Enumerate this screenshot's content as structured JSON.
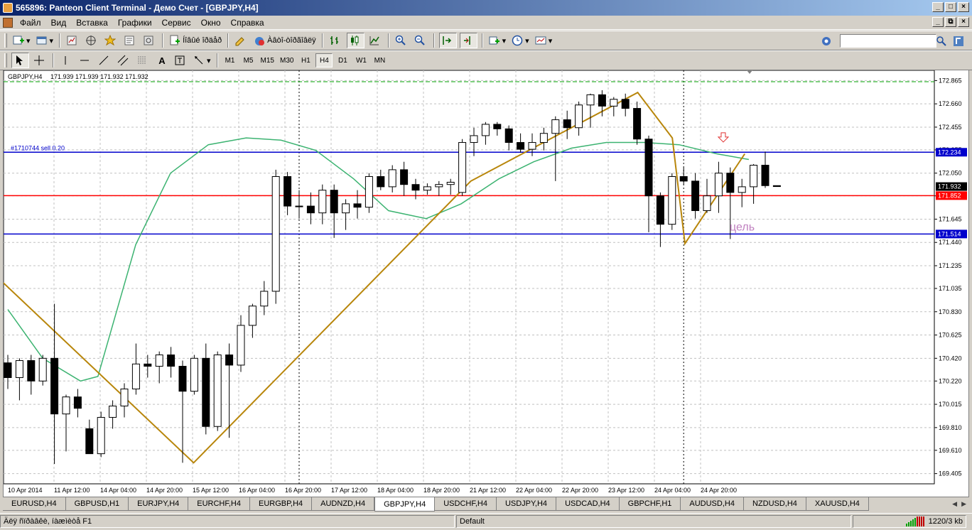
{
  "window": {
    "title": "565896: Panteon Client Terminal - Демо Счет - [GBPJPY,H4]",
    "buttons": [
      "_",
      "□",
      "×"
    ],
    "mdi_buttons": [
      "_",
      "⧉",
      "×"
    ]
  },
  "menu": [
    "Файл",
    "Вид",
    "Вставка",
    "Графики",
    "Сервис",
    "Окно",
    "Справка"
  ],
  "toolbar1": {
    "new_order_label": "Íîâûé îðäåð",
    "expert_label": "Àâòî-òîðãîâëÿ"
  },
  "toolbar2": {
    "timeframes": [
      "M1",
      "M5",
      "M15",
      "M30",
      "H1",
      "H4",
      "D1",
      "W1",
      "MN"
    ],
    "active_timeframe": "H4",
    "text_tool": "A"
  },
  "search": {
    "value": ""
  },
  "chart_data": {
    "type": "candlestick",
    "symbol_label": "GBPJPY,H4",
    "ohlc_header": "171.939 171.939 171.932 171.932",
    "order_label": "#1710744 sell 0.20",
    "target_label": "цель",
    "ylim": [
      169.315,
      172.955
    ],
    "y_ticks": [
      "172.865",
      "172.660",
      "172.455",
      "172.255",
      "172.050",
      "171.850",
      "171.645",
      "171.440",
      "171.235",
      "171.035",
      "170.830",
      "170.625",
      "170.420",
      "170.220",
      "170.015",
      "169.810",
      "169.610",
      "169.405"
    ],
    "x_labels": [
      "10 Apr 2014",
      "11 Apr 12:00",
      "14 Apr 04:00",
      "14 Apr 20:00",
      "15 Apr 12:00",
      "16 Apr 04:00",
      "16 Apr 20:00",
      "17 Apr 12:00",
      "18 Apr 04:00",
      "18 Apr 20:00",
      "21 Apr 12:00",
      "22 Apr 04:00",
      "22 Apr 20:00",
      "23 Apr 12:00",
      "24 Apr 04:00",
      "24 Apr 20:00"
    ],
    "price_labels": [
      {
        "value": 172.234,
        "text": "172.234",
        "color": "#0000cc"
      },
      {
        "value": 171.932,
        "text": "171.932",
        "color": "#000000"
      },
      {
        "value": 171.852,
        "text": "171.852",
        "color": "#ff0000"
      },
      {
        "value": 171.514,
        "text": "171.514",
        "color": "#0000cc"
      }
    ],
    "hlines": [
      {
        "value": 172.234,
        "color": "#0000cc",
        "name": "order-line"
      },
      {
        "value": 171.852,
        "color": "#ff0000",
        "name": "red-level-line"
      },
      {
        "value": 171.514,
        "color": "#0000cc",
        "name": "target-line"
      }
    ],
    "candles": [
      [
        170.38,
        170.45,
        170.15,
        170.25
      ],
      [
        170.25,
        170.42,
        170.05,
        170.4
      ],
      [
        170.4,
        170.45,
        170.1,
        170.22
      ],
      [
        170.22,
        170.45,
        170.18,
        170.42
      ],
      [
        170.42,
        170.9,
        169.49,
        169.93
      ],
      [
        169.93,
        170.1,
        169.6,
        170.08
      ],
      [
        170.08,
        170.15,
        169.9,
        169.98
      ],
      [
        169.8,
        169.88,
        169.6,
        169.58
      ],
      [
        169.58,
        169.95,
        169.55,
        169.9
      ],
      [
        169.9,
        170.05,
        169.8,
        170.0
      ],
      [
        170.0,
        170.2,
        169.9,
        170.15
      ],
      [
        170.15,
        170.55,
        170.1,
        170.37
      ],
      [
        170.37,
        170.45,
        170.25,
        170.35
      ],
      [
        170.35,
        170.48,
        170.2,
        170.45
      ],
      [
        170.45,
        170.52,
        170.25,
        170.35
      ],
      [
        170.35,
        170.4,
        169.5,
        170.13
      ],
      [
        170.13,
        170.45,
        170.1,
        170.42
      ],
      [
        170.42,
        170.55,
        169.75,
        169.82
      ],
      [
        169.82,
        170.48,
        169.78,
        170.45
      ],
      [
        170.45,
        170.55,
        169.72,
        170.36
      ],
      [
        170.36,
        170.8,
        170.3,
        170.71
      ],
      [
        170.71,
        170.9,
        170.6,
        170.88
      ],
      [
        170.88,
        171.1,
        170.8,
        171.01
      ],
      [
        171.01,
        172.08,
        170.9,
        172.02
      ],
      [
        172.02,
        172.06,
        171.68,
        171.76
      ],
      [
        171.76,
        171.9,
        171.65,
        171.76
      ],
      [
        171.76,
        171.88,
        171.6,
        171.7
      ],
      [
        171.7,
        171.95,
        171.6,
        171.9
      ],
      [
        171.9,
        171.95,
        171.48,
        171.7
      ],
      [
        171.7,
        171.82,
        171.55,
        171.78
      ],
      [
        171.78,
        171.9,
        171.65,
        171.75
      ],
      [
        171.75,
        172.05,
        171.7,
        172.02
      ],
      [
        172.02,
        172.08,
        171.9,
        171.93
      ],
      [
        171.93,
        172.12,
        171.88,
        172.08
      ],
      [
        172.08,
        172.15,
        171.85,
        171.95
      ],
      [
        171.95,
        172.0,
        171.82,
        171.9
      ],
      [
        171.9,
        171.96,
        171.86,
        171.93
      ],
      [
        171.93,
        171.98,
        171.85,
        171.95
      ],
      [
        171.95,
        172.0,
        171.86,
        171.97
      ],
      [
        171.88,
        172.35,
        171.85,
        172.32
      ],
      [
        172.32,
        172.45,
        172.2,
        172.38
      ],
      [
        172.38,
        172.5,
        172.3,
        172.48
      ],
      [
        172.48,
        172.5,
        172.38,
        172.44
      ],
      [
        172.44,
        172.47,
        172.25,
        172.32
      ],
      [
        172.32,
        172.4,
        172.23,
        172.26
      ],
      [
        172.26,
        172.4,
        172.2,
        172.32
      ],
      [
        172.32,
        172.45,
        172.25,
        172.4
      ],
      [
        172.4,
        172.55,
        171.98,
        172.52
      ],
      [
        172.52,
        172.6,
        172.35,
        172.45
      ],
      [
        172.45,
        172.68,
        172.38,
        172.65
      ],
      [
        172.65,
        172.75,
        172.45,
        172.74
      ],
      [
        172.74,
        172.78,
        172.55,
        172.64
      ],
      [
        172.64,
        172.72,
        172.55,
        172.7
      ],
      [
        172.7,
        172.75,
        172.55,
        172.62
      ],
      [
        172.62,
        172.68,
        172.3,
        172.35
      ],
      [
        172.35,
        172.38,
        171.53,
        171.85
      ],
      [
        171.85,
        171.88,
        171.4,
        171.6
      ],
      [
        171.6,
        172.05,
        171.55,
        172.02
      ],
      [
        172.02,
        172.1,
        171.95,
        171.98
      ],
      [
        171.98,
        172.05,
        171.65,
        171.72
      ],
      [
        171.72,
        172.0,
        171.7,
        171.85
      ],
      [
        171.85,
        172.15,
        171.7,
        172.05
      ],
      [
        172.05,
        172.1,
        171.47,
        171.88
      ],
      [
        171.88,
        172.0,
        171.75,
        171.93
      ],
      [
        171.93,
        172.13,
        171.78,
        172.12
      ],
      [
        172.12,
        172.24,
        171.92,
        171.94
      ],
      [
        171.94,
        171.94,
        171.93,
        171.932
      ]
    ],
    "ma_series": [
      [
        0,
        170.85
      ],
      [
        12,
        170.42
      ],
      [
        25,
        170.22
      ],
      [
        31,
        170.26
      ],
      [
        44,
        171.42
      ],
      [
        56,
        172.05
      ],
      [
        69,
        172.3
      ],
      [
        82,
        172.36
      ],
      [
        94,
        172.34
      ],
      [
        106,
        172.25
      ],
      [
        119,
        172.0
      ],
      [
        131,
        171.72
      ],
      [
        144,
        171.65
      ],
      [
        156,
        171.78
      ],
      [
        169,
        172.0
      ],
      [
        181,
        172.15
      ],
      [
        194,
        172.27
      ],
      [
        206,
        172.32
      ],
      [
        219,
        172.32
      ],
      [
        231,
        172.3
      ],
      [
        244,
        172.22
      ],
      [
        255,
        172.17
      ]
    ],
    "zigzag": [
      [
        -2,
        171.1
      ],
      [
        59,
        169.5
      ],
      [
        147,
        171.98
      ],
      [
        200,
        172.76
      ],
      [
        211,
        172.36
      ],
      [
        215,
        171.43
      ],
      [
        234,
        172.22
      ]
    ],
    "vlines": [
      25,
      58,
      91,
      124,
      157,
      190,
      223,
      256
    ]
  },
  "tabs": [
    "EURUSD,H4",
    "GBPUSD,H1",
    "EURJPY,H4",
    "EURCHF,H4",
    "EURGBP,H4",
    "AUDNZD,H4",
    "GBPJPY,H4",
    "USDCHF,H4",
    "USDJPY,H4",
    "USDCAD,H4",
    "GBPCHF,H1",
    "AUDUSD,H4",
    "NZDUSD,H4",
    "XAUUSD,H4"
  ],
  "active_tab": "GBPJPY,H4",
  "status": {
    "help": "Äëÿ ñïðàâêè, íàæìèòå F1",
    "profile": "Default",
    "traffic": "1220/3 kb"
  }
}
